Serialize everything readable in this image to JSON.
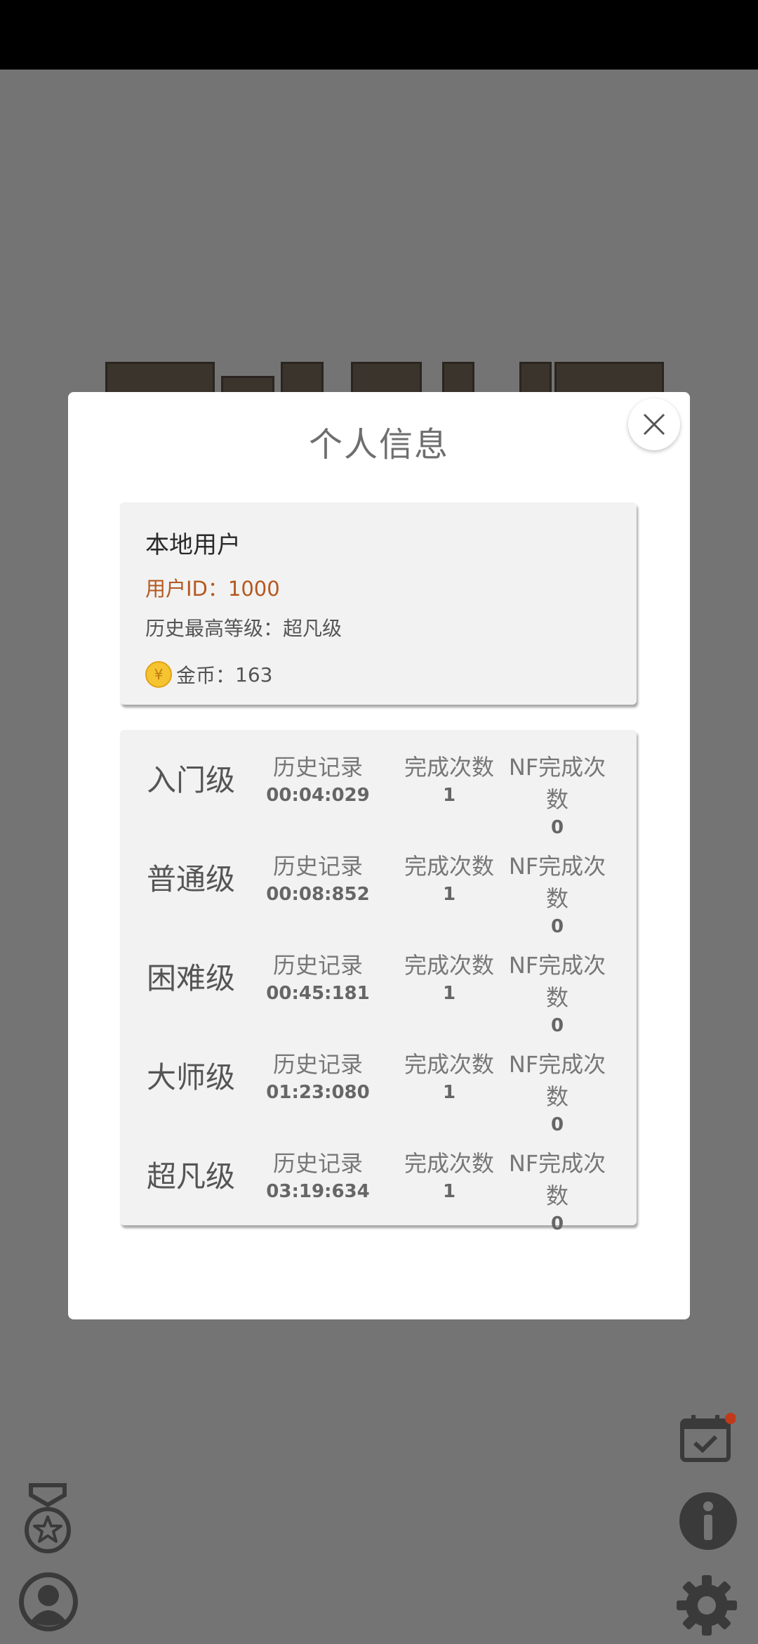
{
  "modal": {
    "title": "个人信息",
    "close_label": "×"
  },
  "user": {
    "name": "本地用户",
    "id_label": "用户ID：",
    "id_value": "1000",
    "best_level_label": "历史最高等级：",
    "best_level_value": "超凡级",
    "coins_label": "金币：",
    "coins_value": "163",
    "coin_symbol": "¥"
  },
  "stats": {
    "col_record": "历史记录",
    "col_complete": "完成次数",
    "col_nf_complete": "NF完成次数",
    "rows": [
      {
        "level": "入门级",
        "record": "00:04:029",
        "complete": "1",
        "nf": "0"
      },
      {
        "level": "普通级",
        "record": "00:08:852",
        "complete": "1",
        "nf": "0"
      },
      {
        "level": "困难级",
        "record": "00:45:181",
        "complete": "1",
        "nf": "0"
      },
      {
        "level": "大师级",
        "record": "01:23:080",
        "complete": "1",
        "nf": "0"
      },
      {
        "level": "超凡级",
        "record": "03:19:634",
        "complete": "1",
        "nf": "0"
      }
    ]
  },
  "icons": {
    "achievement": "medal-icon",
    "profile": "user-icon",
    "checkin": "calendar-check-icon",
    "info": "info-icon",
    "settings": "gear-icon"
  },
  "colors": {
    "overlay": "#747474",
    "user_id": "#b5581f",
    "badge": "#c0391b",
    "coin": "#f5c430"
  }
}
